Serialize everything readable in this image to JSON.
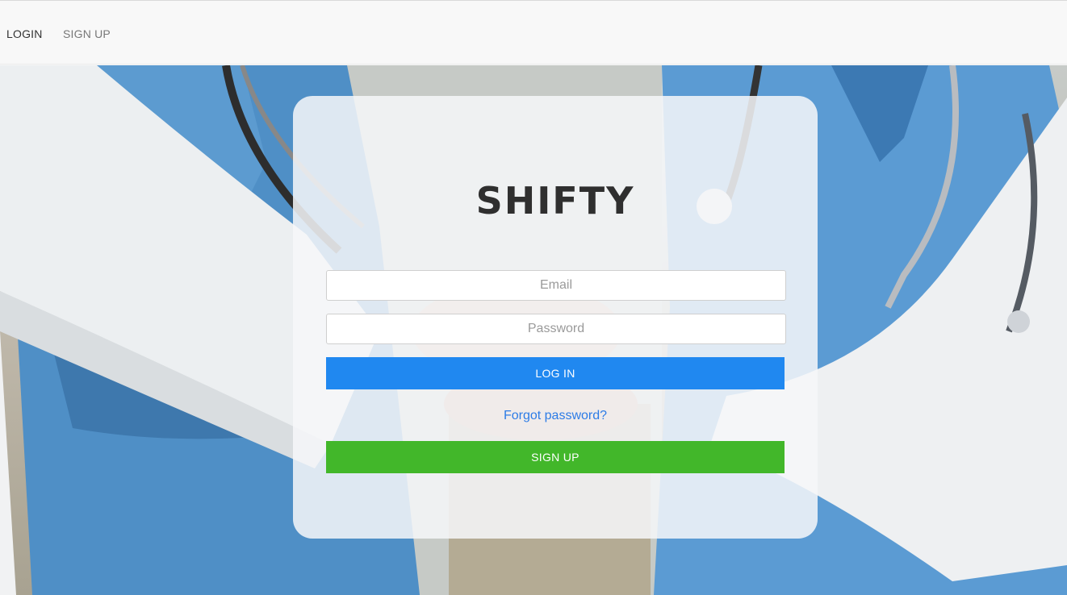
{
  "nav": {
    "login_label": "LOGIN",
    "signup_label": "SIGN UP"
  },
  "card": {
    "brand": "SHIFTY",
    "email": {
      "value": "",
      "placeholder": "Email"
    },
    "password": {
      "value": "",
      "placeholder": "Password"
    },
    "login_button": "LOG IN",
    "forgot_link": "Forgot password?",
    "signup_button": "SIGN UP"
  },
  "colors": {
    "login_button": "#2088f0",
    "signup_button": "#42b72a",
    "link": "#2d7ce6",
    "navbar": "#f8f8f8"
  }
}
